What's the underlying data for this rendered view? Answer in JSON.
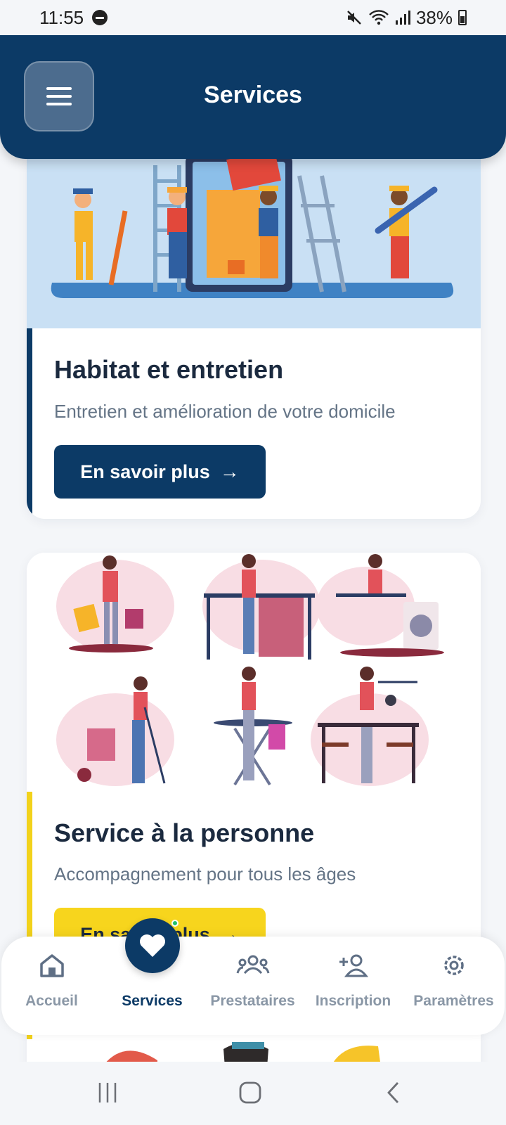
{
  "status_bar": {
    "time": "11:55",
    "battery": "38%"
  },
  "header": {
    "title": "Services"
  },
  "cards": [
    {
      "title": "Habitat et entretien",
      "description": "Entretien et amélioration de votre domicile",
      "button_label": "En savoir plus",
      "accent_color": "#0c3a66"
    },
    {
      "title": "Service à la personne",
      "description": "Accompagnement pour tous les âges",
      "button_label": "En savoir plus",
      "accent_color": "#f2d21b"
    }
  ],
  "bottom_nav": {
    "active": "Services",
    "items": [
      {
        "label": "Accueil",
        "icon": "home-icon"
      },
      {
        "label": "Services",
        "icon": "heart-icon"
      },
      {
        "label": "Prestataires",
        "icon": "users-icon"
      },
      {
        "label": "Inscription",
        "icon": "add-user-icon"
      },
      {
        "label": "Paramètres",
        "icon": "gear-icon"
      }
    ]
  },
  "colors": {
    "primary": "#0c3a66",
    "accent": "#f7d51d",
    "background": "#f4f6f9"
  }
}
